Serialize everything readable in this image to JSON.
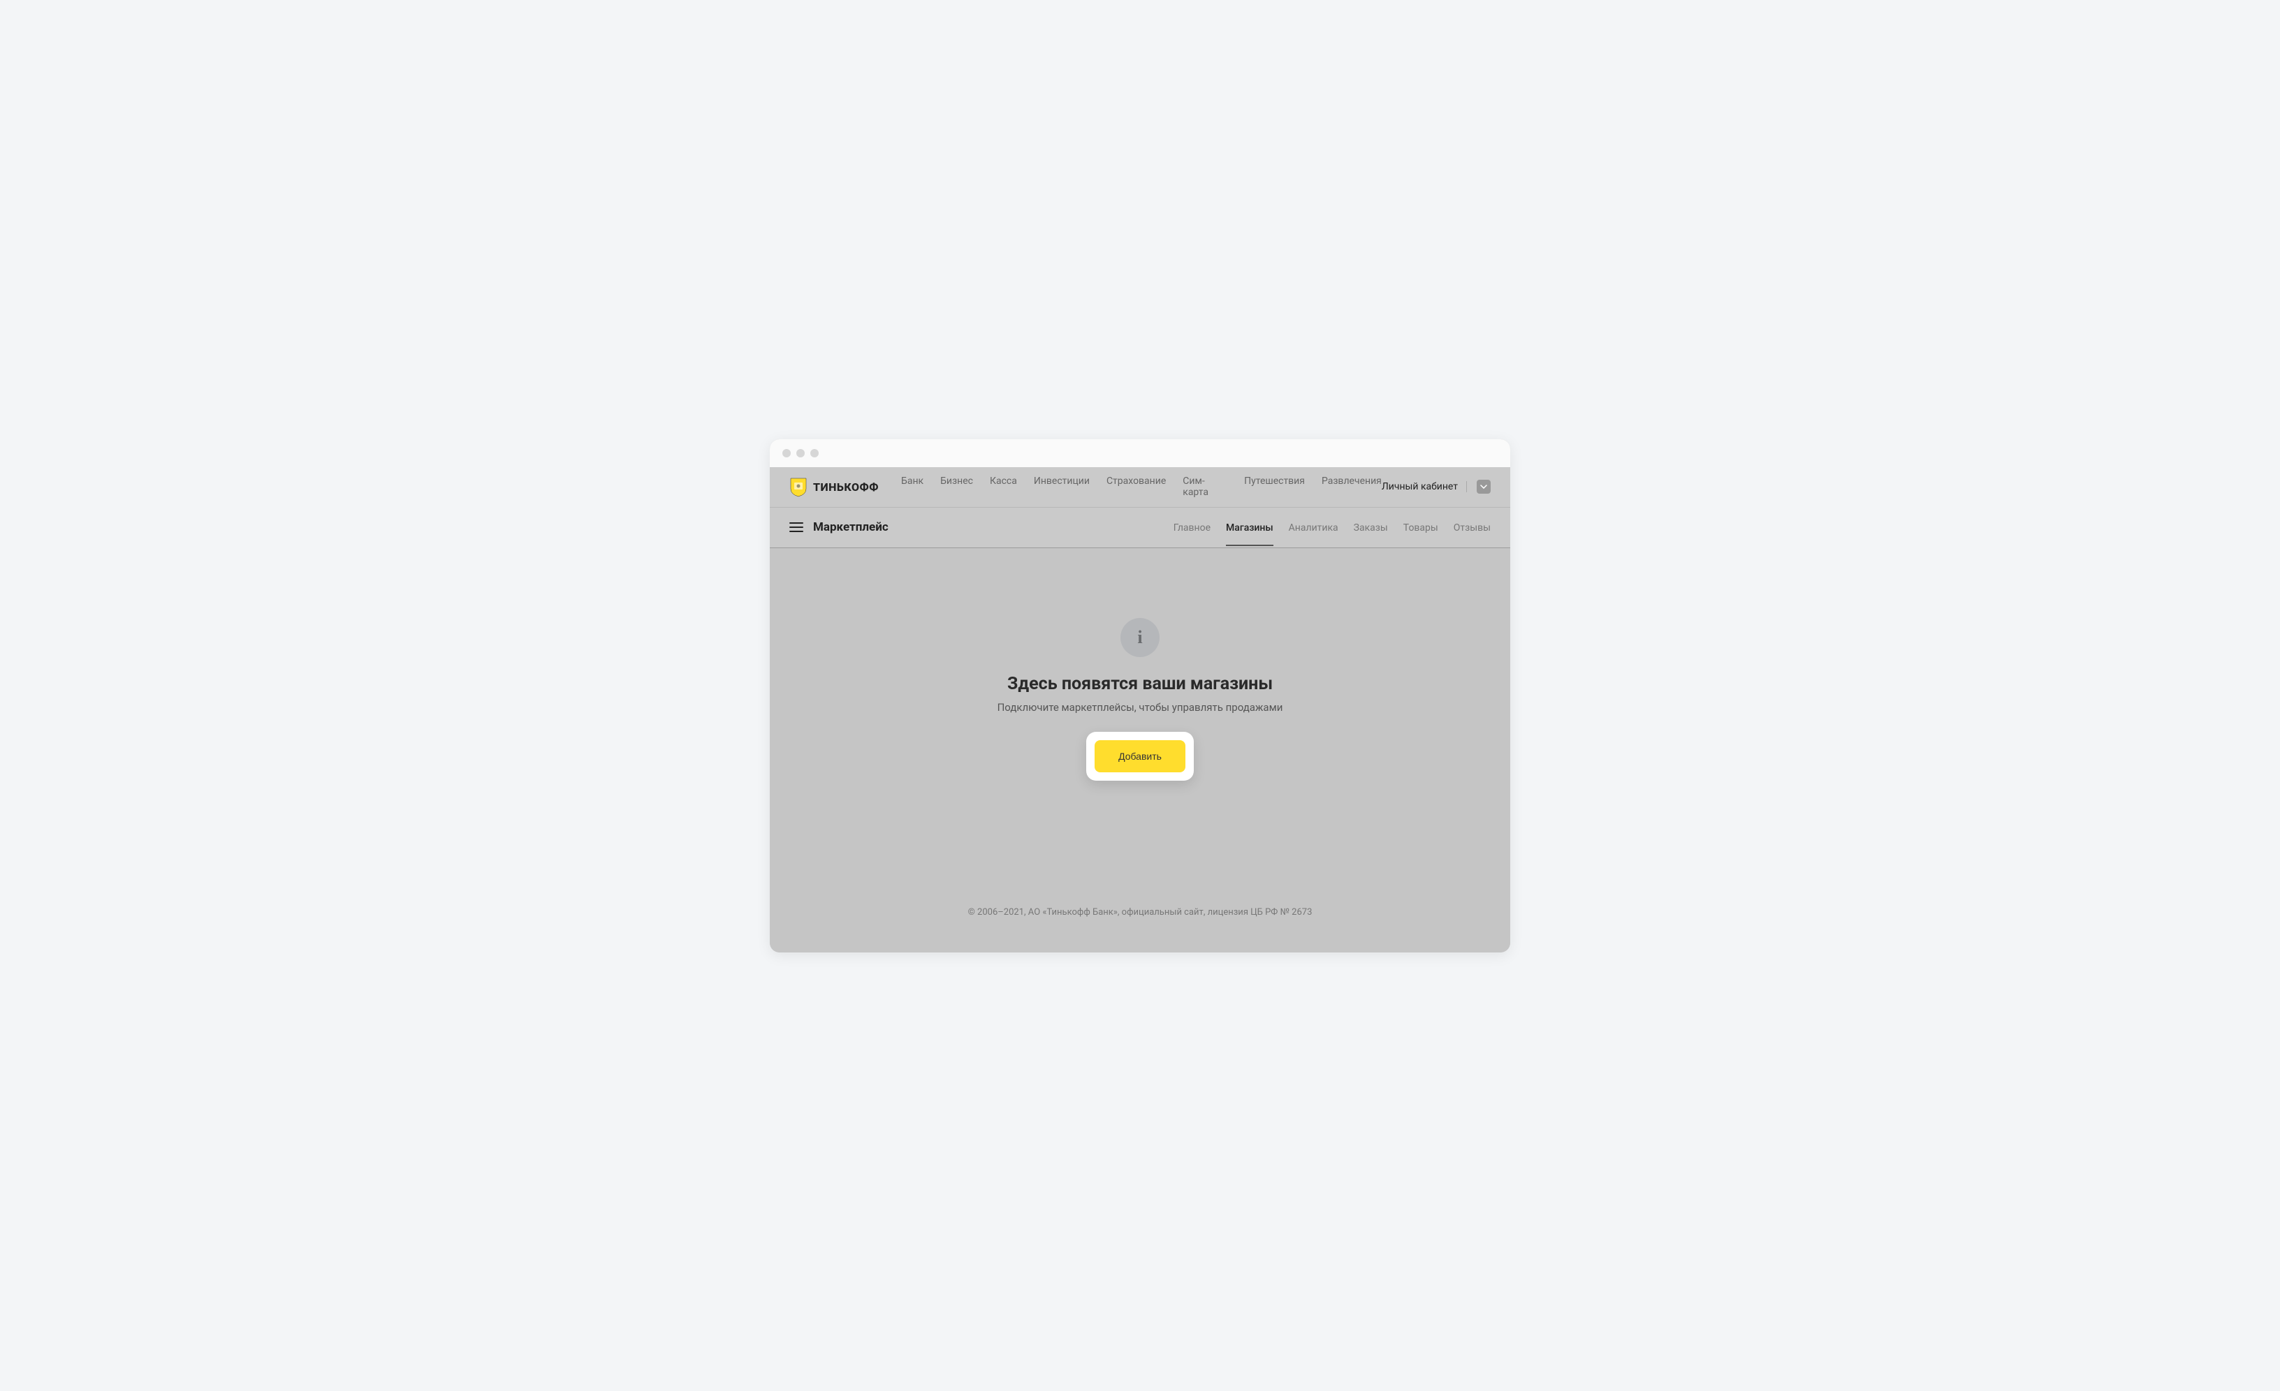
{
  "brand": {
    "name": "ТИНЬКОФФ"
  },
  "top_nav": {
    "items": [
      {
        "label": "Банк"
      },
      {
        "label": "Бизнес"
      },
      {
        "label": "Касса"
      },
      {
        "label": "Инвестиции"
      },
      {
        "label": "Страхование"
      },
      {
        "label": "Сим-карта"
      },
      {
        "label": "Путешествия"
      },
      {
        "label": "Развлечения"
      }
    ],
    "account_label": "Личный кабинет"
  },
  "sub_nav": {
    "section_title": "Маркетплейс",
    "items": [
      {
        "label": "Главное",
        "active": false
      },
      {
        "label": "Магазины",
        "active": true
      },
      {
        "label": "Аналитика",
        "active": false
      },
      {
        "label": "Заказы",
        "active": false
      },
      {
        "label": "Товары",
        "active": false
      },
      {
        "label": "Отзывы",
        "active": false
      }
    ]
  },
  "empty_state": {
    "title": "Здесь появятся ваши магазины",
    "subtitle": "Подключите маркетплейсы, чтобы управлять продажами",
    "add_button": "Добавить"
  },
  "footer": {
    "copyright": "© 2006–2021, АО «Тинькофф Банк», официальный сайт, лицензия ЦБ РФ № 2673"
  }
}
